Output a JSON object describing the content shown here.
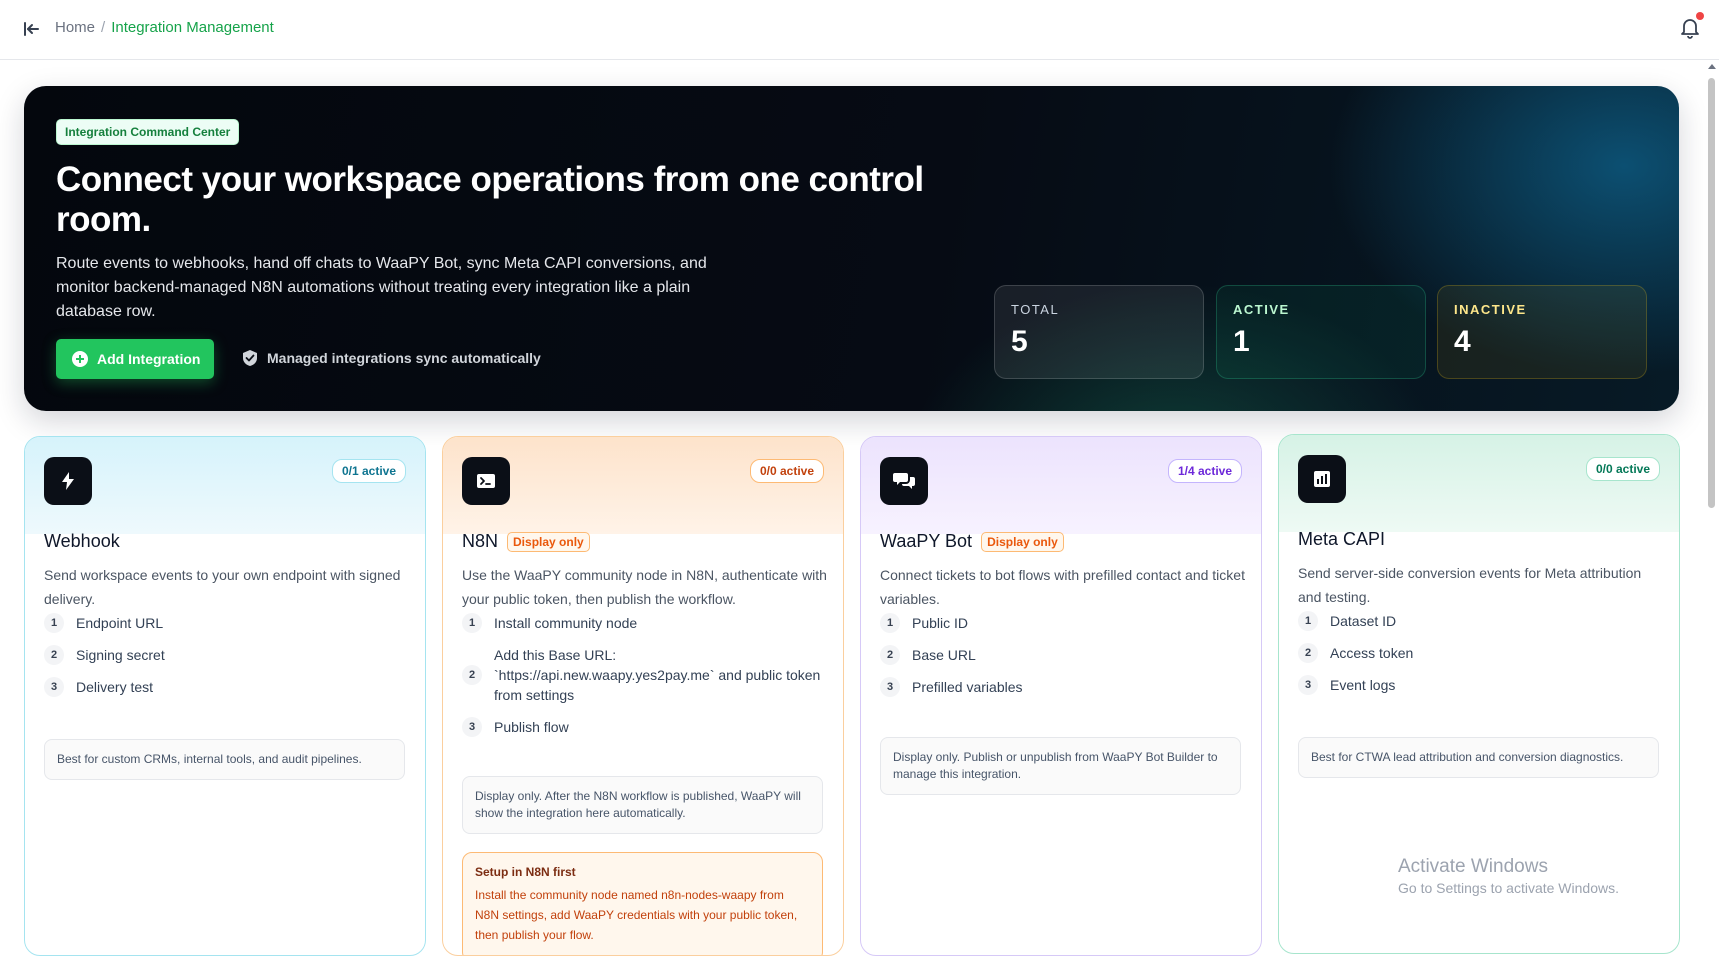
{
  "breadcrumb": {
    "home": "Home",
    "separator": "/",
    "current": "Integration Management"
  },
  "hero": {
    "badge": "Integration Command Center",
    "title": "Connect your workspace operations from one control room.",
    "description": "Route events to webhooks, hand off chats to WaaPY Bot, sync Meta CAPI conversions, and monitor backend-managed N8N automations without treating every integration like a plain database row.",
    "add_button": "Add Integration",
    "managed_note": "Managed integrations sync automatically",
    "stats": {
      "total": {
        "label": "TOTAL",
        "value": "5"
      },
      "active": {
        "label": "ACTIVE",
        "value": "1"
      },
      "inactive": {
        "label": "INACTIVE",
        "value": "4"
      }
    }
  },
  "cards": [
    {
      "key": "webhook",
      "icon": "lightning-icon",
      "title": "Webhook",
      "badge": "",
      "status": "0/1 active",
      "description": "Send workspace events to your own endpoint with signed delivery.",
      "steps": [
        "Endpoint URL",
        "Signing secret",
        "Delivery test"
      ],
      "note": "Best for custom CRMs, internal tools, and audit pipelines."
    },
    {
      "key": "n8n",
      "icon": "terminal-icon",
      "title": "N8N",
      "badge": "Display only",
      "status": "0/0 active",
      "description": "Use the WaaPY community node in N8N, authenticate with your public token, then publish the workflow.",
      "steps": [
        "Install community node",
        "Add this Base URL: `https://api.new.waapy.yes2pay.me` and public token from settings",
        "Publish flow"
      ],
      "note": "Display only. After the N8N workflow is published, WaaPY will show the integration here automatically.",
      "setup_title": "Setup in N8N first",
      "setup_body": "Install the community node named n8n-nodes-waapy from N8N settings, add WaaPY credentials with your public token, then publish your flow."
    },
    {
      "key": "waapy",
      "icon": "chat-bubbles-icon",
      "title": "WaaPY Bot",
      "badge": "Display only",
      "status": "1/4 active",
      "description": "Connect tickets to bot flows with prefilled contact and ticket variables.",
      "steps": [
        "Public ID",
        "Base URL",
        "Prefilled variables"
      ],
      "note": "Display only. Publish or unpublish from WaaPY Bot Builder to manage this integration."
    },
    {
      "key": "meta",
      "icon": "bar-chart-icon",
      "title": "Meta CAPI",
      "badge": "",
      "status": "0/0 active",
      "description": "Send server-side conversion events for Meta attribution and testing.",
      "steps": [
        "Dataset ID",
        "Access token",
        "Event logs"
      ],
      "note": "Best for CTWA lead attribution and conversion diagnostics."
    }
  ],
  "watermark": {
    "line1": "Activate Windows",
    "line2": "Go to Settings to activate Windows."
  },
  "colors": {
    "accent": "#16a34a",
    "button": "#22c55e",
    "hero_bg": "#05090f"
  }
}
